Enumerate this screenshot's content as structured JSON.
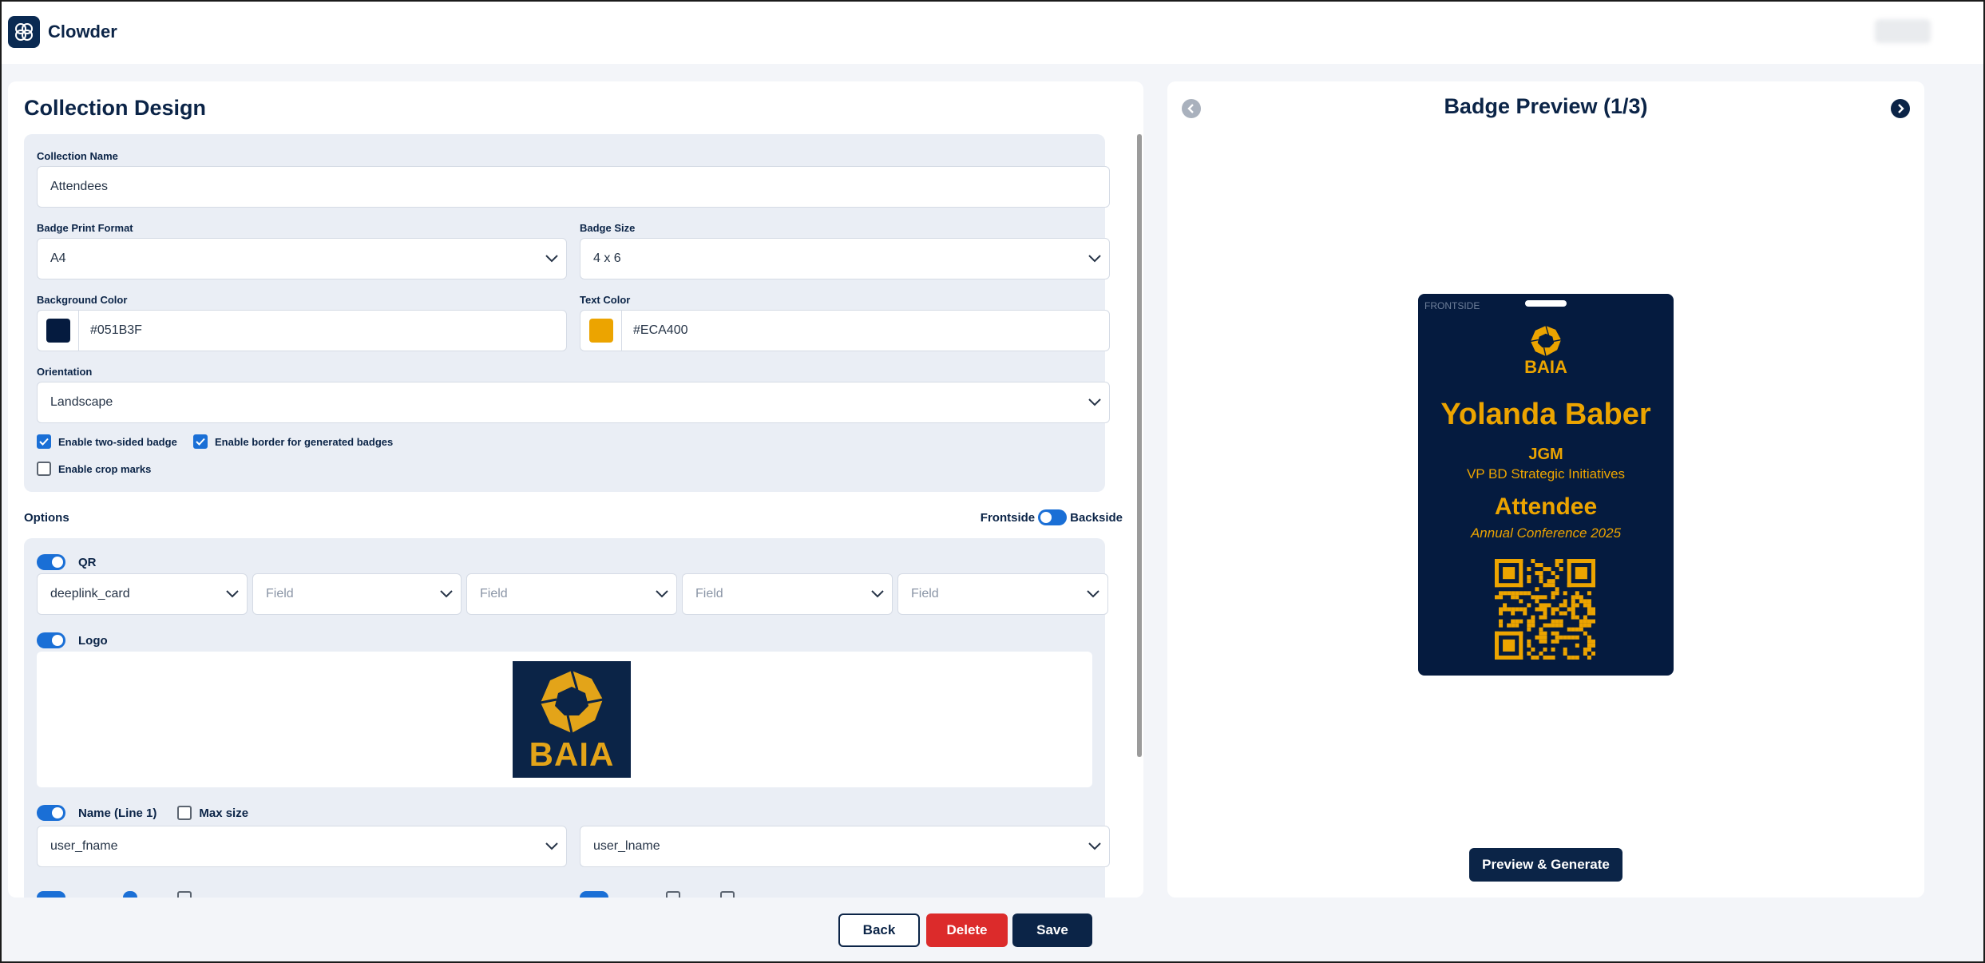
{
  "app": {
    "name": "Clowder"
  },
  "left": {
    "title": "Collection Design",
    "collection_name": {
      "label": "Collection Name",
      "value": "Attendees"
    },
    "print_format": {
      "label": "Badge Print Format",
      "value": "A4"
    },
    "badge_size": {
      "label": "Badge Size",
      "value": "4 x 6"
    },
    "background_color": {
      "label": "Background Color",
      "value": "#051B3F",
      "swatch": "#051B3F"
    },
    "text_color": {
      "label": "Text Color",
      "value": "#ECA400",
      "swatch": "#ECA400"
    },
    "orientation": {
      "label": "Orientation",
      "value": "Landscape"
    },
    "checks": [
      {
        "label": "Enable two-sided badge",
        "checked": true
      },
      {
        "label": "Enable border for generated badges",
        "checked": true
      },
      {
        "label": "Enable crop marks",
        "checked": false
      }
    ]
  },
  "options": {
    "title": "Options",
    "frontside_label": "Frontside",
    "backside_label": "Backside",
    "qr": {
      "label": "QR",
      "enabled": true,
      "fields": [
        "deeplink_card",
        "Field",
        "Field",
        "Field",
        "Field"
      ]
    },
    "logo": {
      "label": "Logo",
      "enabled": true,
      "logo_text": "BAIA"
    },
    "name_line1": {
      "label": "Name (Line 1)",
      "enabled": true,
      "max_size_label": "Max size",
      "max_size_checked": false,
      "fields": [
        "user_fname",
        "user_lname"
      ]
    }
  },
  "preview": {
    "title": "Badge Preview (1/3)",
    "side_label": "FRONTSIDE",
    "logo_text": "BAIA",
    "name": "Yolanda Baber",
    "company": "JGM",
    "job_title": "VP BD Strategic Initiatives",
    "role": "Attendee",
    "event": "Annual Conference 2025",
    "generate_label": "Preview & Generate"
  },
  "footer": {
    "back_label": "Back",
    "delete_label": "Delete",
    "save_label": "Save"
  },
  "colors": {
    "brand_navy": "#0b2447",
    "badge_bg": "#051B3F",
    "badge_text": "#ECA400",
    "accent_blue": "#1a6fd6",
    "danger": "#dc2b2b"
  }
}
